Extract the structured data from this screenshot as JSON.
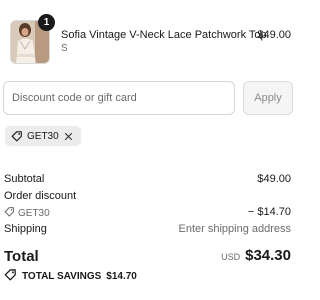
{
  "line_item": {
    "quantity": "1",
    "name": "Sofia Vintage V-Neck Lace Patchwork Top",
    "variant": "S",
    "price": "$49.00",
    "image_icon": "product-photo"
  },
  "discount": {
    "placeholder": "Discount code or gift card",
    "apply_label": "Apply",
    "applied_code": "GET30"
  },
  "summary": {
    "subtotal_label": "Subtotal",
    "subtotal_value": "$49.00",
    "order_discount_label": "Order discount",
    "order_discount_code": "GET30",
    "order_discount_value": "− $14.70",
    "shipping_label": "Shipping",
    "shipping_value": "Enter shipping address",
    "total_label": "Total",
    "currency": "USD",
    "total_value": "$34.30",
    "savings_label": "TOTAL SAVINGS",
    "savings_value": "$14.70"
  },
  "colors": {
    "text": "#1a1a1a",
    "muted": "#6b6b6b",
    "chip_bg": "#ececec",
    "apply_bg": "#f5f5f5"
  }
}
